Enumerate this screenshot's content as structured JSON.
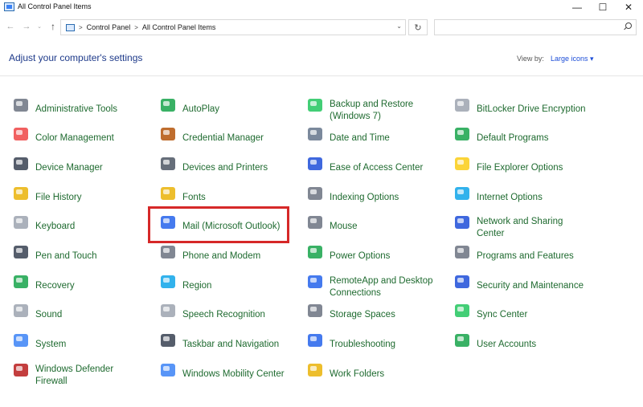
{
  "window": {
    "title": "All Control Panel Items",
    "controls": {
      "minimize": "—",
      "maximize": "☐",
      "close": "✕"
    }
  },
  "nav": {
    "back": "←",
    "forward": "→",
    "recent": "⌄",
    "up": "↑",
    "breadcrumb": [
      "Control Panel",
      "All Control Panel Items"
    ],
    "separator": ">",
    "dropdown": "⌄",
    "refresh": "↻",
    "search_placeholder": ""
  },
  "header": {
    "title": "Adjust your computer's settings",
    "view_by_label": "View by:",
    "view_by_value": "Large icons ▾"
  },
  "items": [
    {
      "label": "Administrative Tools",
      "icon": "admin-tools-icon",
      "color": "#6b7280"
    },
    {
      "label": "AutoPlay",
      "icon": "autoplay-icon",
      "color": "#16a34a"
    },
    {
      "label": "Backup and Restore (Windows 7)",
      "icon": "backup-icon",
      "color": "#22c55e"
    },
    {
      "label": "BitLocker Drive Encryption",
      "icon": "bitlocker-icon",
      "color": "#9ca3af"
    },
    {
      "label": "Color Management",
      "icon": "color-management-icon",
      "color": "#ef4444"
    },
    {
      "label": "Credential Manager",
      "icon": "credential-manager-icon",
      "color": "#b45309"
    },
    {
      "label": "Date and Time",
      "icon": "date-time-icon",
      "color": "#64748b"
    },
    {
      "label": "Default Programs",
      "icon": "default-programs-icon",
      "color": "#16a34a"
    },
    {
      "label": "Device Manager",
      "icon": "device-manager-icon",
      "color": "#374151"
    },
    {
      "label": "Devices and Printers",
      "icon": "printer-icon",
      "color": "#4b5563"
    },
    {
      "label": "Ease of Access Center",
      "icon": "ease-of-access-icon",
      "color": "#1d4ed8"
    },
    {
      "label": "File Explorer Options",
      "icon": "folder-options-icon",
      "color": "#facc15"
    },
    {
      "label": "File History",
      "icon": "file-history-icon",
      "color": "#eab308"
    },
    {
      "label": "Fonts",
      "icon": "fonts-icon",
      "color": "#eab308"
    },
    {
      "label": "Indexing Options",
      "icon": "indexing-icon",
      "color": "#6b7280"
    },
    {
      "label": "Internet Options",
      "icon": "internet-options-icon",
      "color": "#0ea5e9"
    },
    {
      "label": "Keyboard",
      "icon": "keyboard-icon",
      "color": "#9ca3af"
    },
    {
      "label": "Mail (Microsoft Outlook)",
      "icon": "mail-icon",
      "color": "#2563eb"
    },
    {
      "label": "Mouse",
      "icon": "mouse-icon",
      "color": "#6b7280"
    },
    {
      "label": "Network and Sharing Center",
      "icon": "network-icon",
      "color": "#1d4ed8"
    },
    {
      "label": "Pen and Touch",
      "icon": "pen-icon",
      "color": "#374151"
    },
    {
      "label": "Phone and Modem",
      "icon": "phone-modem-icon",
      "color": "#6b7280"
    },
    {
      "label": "Power Options",
      "icon": "power-icon",
      "color": "#16a34a"
    },
    {
      "label": "Programs and Features",
      "icon": "programs-icon",
      "color": "#6b7280"
    },
    {
      "label": "Recovery",
      "icon": "recovery-icon",
      "color": "#16a34a"
    },
    {
      "label": "Region",
      "icon": "region-icon",
      "color": "#0ea5e9"
    },
    {
      "label": "RemoteApp and Desktop Connections",
      "icon": "remoteapp-icon",
      "color": "#2563eb"
    },
    {
      "label": "Security and Maintenance",
      "icon": "security-flag-icon",
      "color": "#1d4ed8"
    },
    {
      "label": "Sound",
      "icon": "sound-icon",
      "color": "#9ca3af"
    },
    {
      "label": "Speech Recognition",
      "icon": "microphone-icon",
      "color": "#9ca3af"
    },
    {
      "label": "Storage Spaces",
      "icon": "storage-icon",
      "color": "#6b7280"
    },
    {
      "label": "Sync Center",
      "icon": "sync-icon",
      "color": "#22c55e"
    },
    {
      "label": "System",
      "icon": "system-icon",
      "color": "#3b82f6"
    },
    {
      "label": "Taskbar and Navigation",
      "icon": "taskbar-icon",
      "color": "#374151"
    },
    {
      "label": "Troubleshooting",
      "icon": "troubleshooting-icon",
      "color": "#2563eb"
    },
    {
      "label": "User Accounts",
      "icon": "user-accounts-icon",
      "color": "#16a34a"
    },
    {
      "label": "Windows Defender Firewall",
      "icon": "firewall-icon",
      "color": "#b91c1c"
    },
    {
      "label": "Windows Mobility Center",
      "icon": "mobility-center-icon",
      "color": "#3b82f6"
    },
    {
      "label": "Work Folders",
      "icon": "work-folders-icon",
      "color": "#eab308"
    }
  ],
  "highlight": {
    "target": "Mail (Microsoft Outlook)",
    "color": "#d62828"
  }
}
